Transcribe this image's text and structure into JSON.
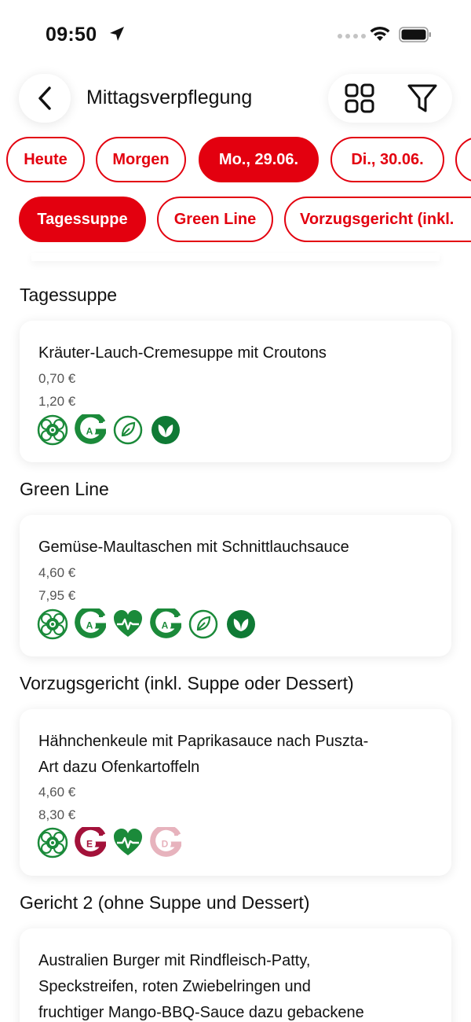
{
  "status_bar": {
    "time": "09:50"
  },
  "header": {
    "title": "Mittagsverpflegung"
  },
  "date_chips": [
    {
      "label": "Heute",
      "active": false
    },
    {
      "label": "Morgen",
      "active": false
    },
    {
      "label": "Mo., 29.06.",
      "active": true
    },
    {
      "label": "Di., 30.06.",
      "active": false
    }
  ],
  "category_chips": [
    {
      "label": "Tagessuppe",
      "active": true
    },
    {
      "label": "Green Line",
      "active": false
    },
    {
      "label": "Vorzugsgericht (inkl.",
      "active": false
    }
  ],
  "sections": [
    {
      "title": "Tagessuppe",
      "dish": "Kräuter-Lauch-Cremesuppe mit Croutons",
      "prices": [
        "0,70 €",
        "1,20 €"
      ],
      "badges": [
        "flower-badge-icon",
        "grade-a-badge-icon",
        "leaf-outline-icon",
        "vegan-leaf-icon"
      ]
    },
    {
      "title": "Green Line",
      "dish": "Gemüse-Maultaschen mit Schnittlauchsauce",
      "prices": [
        "4,60 €",
        "7,95 €"
      ],
      "badges": [
        "flower-badge-icon",
        "grade-a-badge-icon",
        "heart-badge-icon",
        "grade-a-badge-icon",
        "leaf-outline-icon",
        "vegan-leaf-icon"
      ]
    },
    {
      "title": "Vorzugsgericht (inkl. Suppe oder Dessert)",
      "dish_lines": [
        "Hähnchenkeule mit Paprikasauce nach Puszta-",
        "Art dazu Ofenkartoffeln"
      ],
      "prices": [
        "4,60 €",
        "8,30 €"
      ],
      "badges": [
        "flower-badge-icon",
        "grade-e-badge-icon",
        "heart-badge-icon",
        "grade-d-badge-icon"
      ]
    },
    {
      "title": "Gericht 2 (ohne Suppe und Dessert)",
      "dish_lines": [
        "Australien Burger mit Rindfleisch-Patty,",
        "Speckstreifen, roten Zwiebelringen und",
        "fruchtiger Mango-BBQ-Sauce dazu gebackene"
      ]
    }
  ],
  "badge_labels": {
    "a": "A",
    "e": "E",
    "d": "D"
  },
  "colors": {
    "accent": "#e3000f",
    "green": "#1b8a3a",
    "dark_green": "#0f7a35",
    "burgundy": "#a3123a",
    "pink": "#e7b3bd"
  }
}
